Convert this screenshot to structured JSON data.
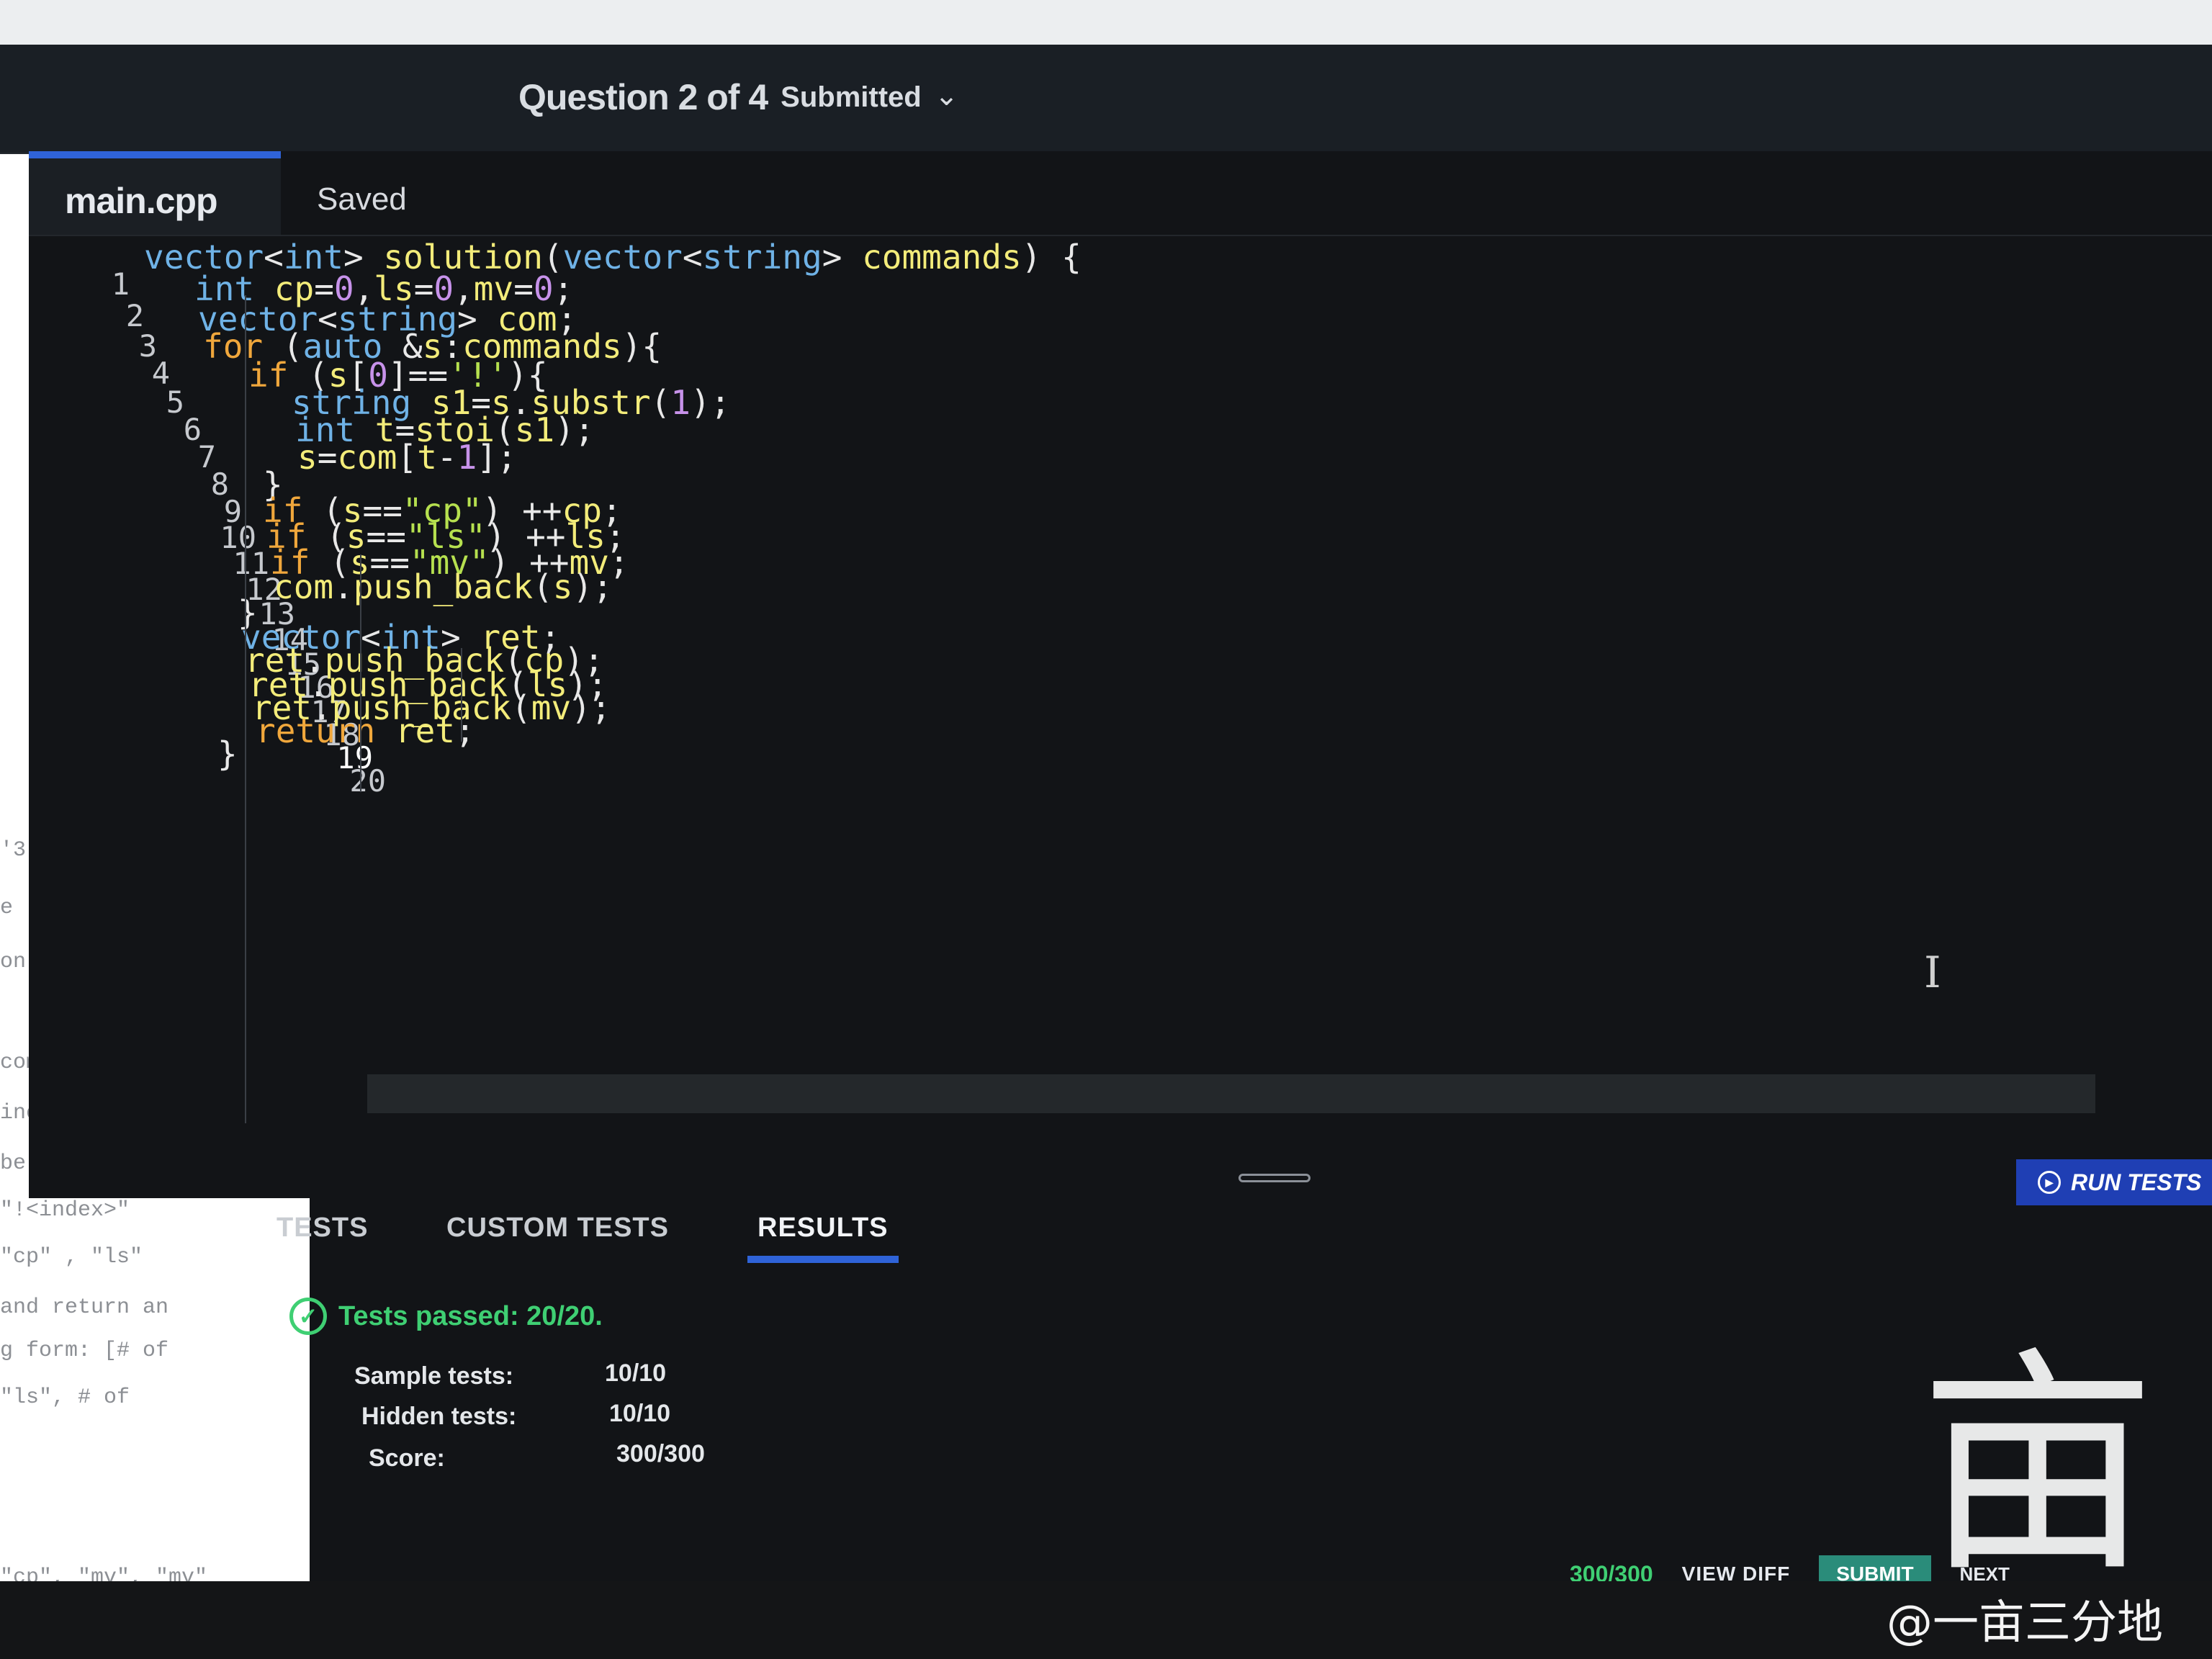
{
  "header": {
    "question_label": "Question 2 of 4",
    "status": "Submitted"
  },
  "editor": {
    "file_tab": "main.cpp",
    "save_status": "Saved",
    "current_line": 19,
    "lines": [
      {
        "n": "1",
        "text": "vector<int> solution(vector<string> commands) {"
      },
      {
        "n": "2",
        "text": "int cp=0,ls=0,mv=0;"
      },
      {
        "n": "3",
        "text": "vector<string> com;"
      },
      {
        "n": "4",
        "text": "for (auto &s:commands){"
      },
      {
        "n": "5",
        "text": "if (s[0]=='!'){"
      },
      {
        "n": "6",
        "text": "string s1=s.substr(1);"
      },
      {
        "n": "7",
        "text": "int t=stoi(s1);"
      },
      {
        "n": "8",
        "text": "s=com[t-1];"
      },
      {
        "n": "9",
        "text": "}"
      },
      {
        "n": "10",
        "text": "if (s==\"cp\") ++cp;"
      },
      {
        "n": "11",
        "text": "if (s==\"ls\") ++ls;"
      },
      {
        "n": "12",
        "text": "if (s==\"mv\") ++mv;"
      },
      {
        "n": "13",
        "text": "com.push_back(s);"
      },
      {
        "n": "14",
        "text": "}"
      },
      {
        "n": "15",
        "text": "vector<int> ret;"
      },
      {
        "n": "16",
        "text": "ret.push_back(cp);"
      },
      {
        "n": "17",
        "text": "ret.push_back(ls);"
      },
      {
        "n": "18",
        "text": "ret.push_back(mv);"
      },
      {
        "n": "19",
        "text": "return ret;"
      },
      {
        "n": "20",
        "text": "}"
      }
    ]
  },
  "description_fragments": [
    "'3\"",
    "e",
    "on of",
    "commands",
    "ince the",
    "be one of",
    "\"!<index>\"",
    "\"cp\" , \"ls\"",
    "and return an",
    "g form: [# of",
    "\"ls\", # of",
    "\"cp\", \"mv\", \"mv\""
  ],
  "bottom_panel": {
    "tabs": [
      "TESTS",
      "CUSTOM TESTS",
      "RESULTS"
    ],
    "active_tab": "RESULTS",
    "run_tests_label": "RUN TESTS",
    "tests_passed": "Tests passed: 20/20.",
    "sample_label": "Sample tests:",
    "sample_value": "10/10",
    "hidden_label": "Hidden tests:",
    "hidden_value": "10/10",
    "score_label": "Score:",
    "score_value": "300/300"
  },
  "footer": {
    "score": "300/300",
    "view_diff": "VIEW DIFF",
    "submit": "SUBMIT",
    "next": "NEXT"
  },
  "watermark": {
    "seal_char": "亩",
    "text": "@一亩三分地"
  },
  "colors": {
    "keyword": "#f0a73c",
    "type": "#6fb2e6",
    "identifier": "#f3ec7a",
    "string": "#b6e04f",
    "number": "#c792ea",
    "success": "#3fcf73",
    "accent": "#2f63d8"
  }
}
